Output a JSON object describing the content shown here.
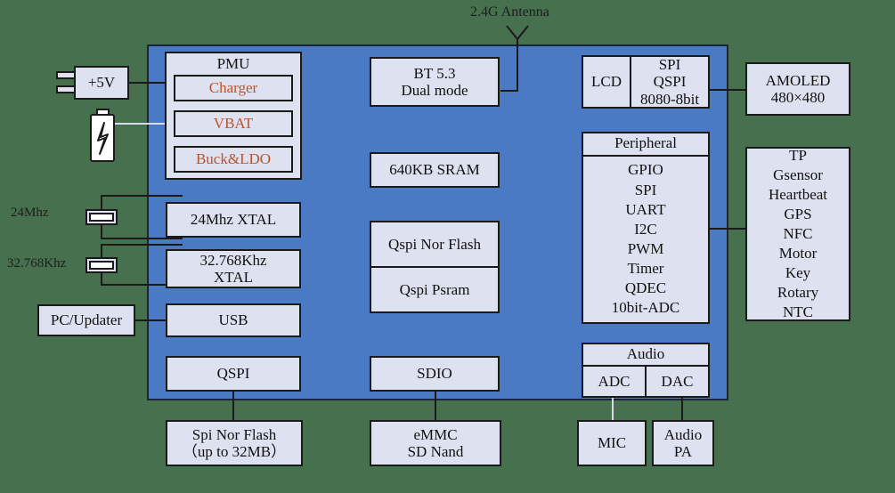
{
  "diagram": {
    "title": "SoC block diagram",
    "colors": {
      "background": "#47704f",
      "soc_fill": "#4a7ac4",
      "box_fill": "#dde1f0",
      "stroke": "#1a1a1a",
      "accent_text": "#c0522a"
    }
  },
  "antenna": {
    "label": "2.4G Antenna",
    "icon": "antenna-icon"
  },
  "power": {
    "adapter": {
      "label": "+5V",
      "icon": "power-adapter-icon"
    },
    "battery": {
      "icon": "battery-icon"
    }
  },
  "clocks": {
    "xtal_24_label": "24Mhz",
    "xtal_32_label": "32.768Khz",
    "xtal_icon": "crystal-icon"
  },
  "external_left": {
    "pc_updater": "PC/Updater"
  },
  "pmu": {
    "title": "PMU",
    "rails": [
      "Charger",
      "VBAT",
      "Buck&LDO"
    ]
  },
  "left_column": [
    {
      "lines": [
        "24Mhz XTAL"
      ]
    },
    {
      "lines": [
        "32.768Khz",
        "XTAL"
      ]
    },
    {
      "lines": [
        "USB"
      ]
    },
    {
      "lines": [
        "QSPI"
      ]
    }
  ],
  "center_column": {
    "bt": {
      "lines": [
        "BT 5.3",
        "Dual mode"
      ]
    },
    "sram": {
      "lines": [
        "640KB SRAM"
      ]
    },
    "memory_split": [
      "Qspi Nor Flash",
      "Qspi Psram"
    ],
    "sdio": {
      "lines": [
        "SDIO"
      ]
    }
  },
  "right_column": {
    "lcd": {
      "name": "LCD",
      "modes": [
        "SPI",
        "QSPI",
        "8080-8bit"
      ]
    },
    "peripheral": {
      "title": "Peripheral",
      "items": [
        "GPIO",
        "SPI",
        "UART",
        "I2C",
        "PWM",
        "Timer",
        "QDEC",
        "10bit-ADC"
      ]
    },
    "audio": {
      "title": "Audio",
      "cells": [
        "ADC",
        "DAC"
      ]
    }
  },
  "external_right": {
    "display": {
      "lines": [
        "AMOLED",
        "480×480"
      ]
    },
    "sensors": [
      "TP",
      "Gsensor",
      "Heartbeat",
      "GPS",
      "NFC",
      "Motor",
      "Key",
      "Rotary",
      "NTC"
    ]
  },
  "external_bottom": {
    "spi_nor_flash": {
      "lines": [
        "Spi Nor Flash",
        "（up to 32MB）"
      ]
    },
    "emmc": {
      "lines": [
        "eMMC",
        "SD Nand"
      ]
    },
    "mic": {
      "lines": [
        "MIC"
      ]
    },
    "audio_pa": {
      "lines": [
        "Audio",
        "PA"
      ]
    }
  }
}
